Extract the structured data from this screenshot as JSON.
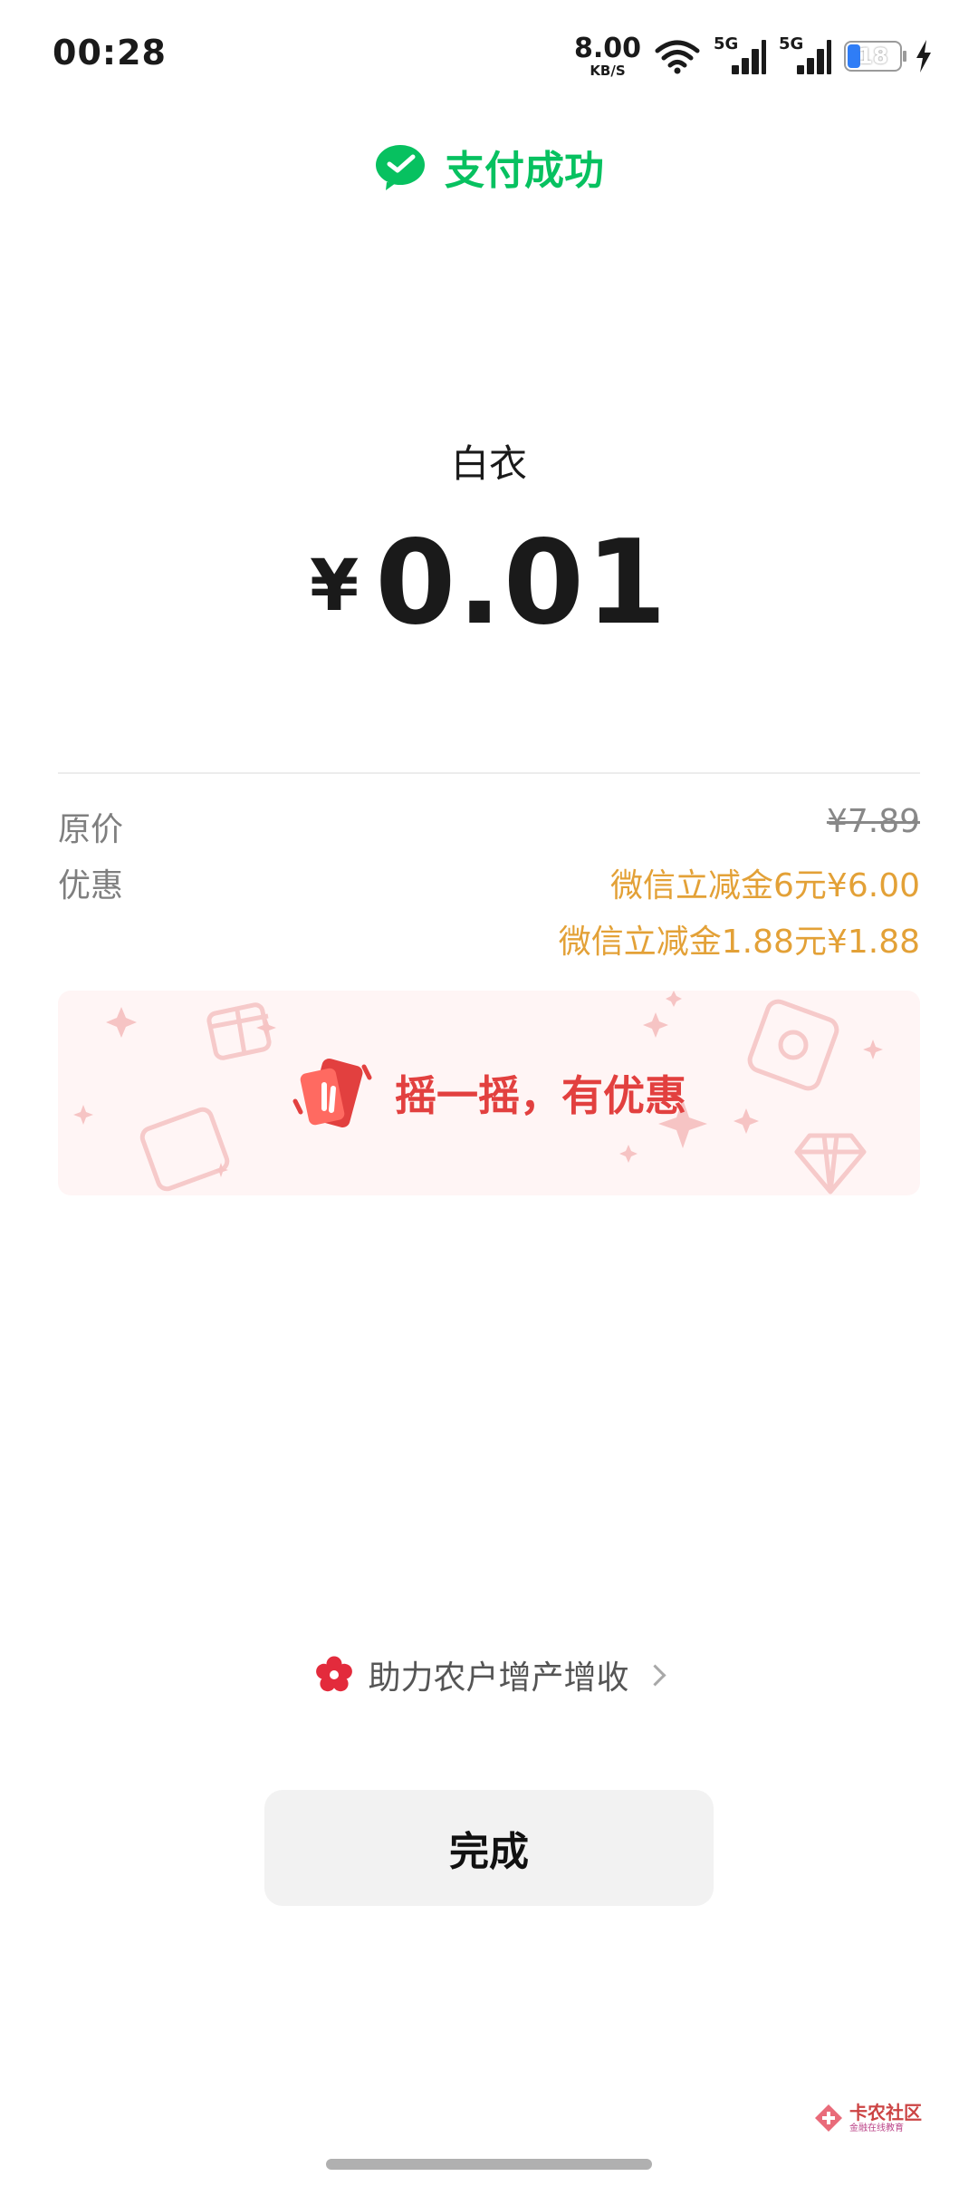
{
  "status_bar": {
    "time": "00:28",
    "net_speed_value": "8.00",
    "net_speed_unit": "KB/S",
    "signal_1": "5G",
    "signal_2": "5G",
    "battery_level": "18",
    "icons": [
      "wifi-icon",
      "signal-icon",
      "signal-icon",
      "battery-icon",
      "charging-icon"
    ]
  },
  "header": {
    "status": "支付成功",
    "icon": "wechat-pay-icon",
    "brand_color": "#07c160"
  },
  "payment": {
    "merchant": "白衣",
    "currency": "¥",
    "amount": "0.01"
  },
  "details": {
    "original_label": "原价",
    "original_price": "¥7.89",
    "discount_label": "优惠",
    "discounts": [
      "微信立减金6元¥6.00",
      "微信立减金1.88元¥1.88"
    ],
    "discount_color": "#e3a137"
  },
  "promo": {
    "text": "摇一摇，有优惠",
    "icon": "shake-phone-icon",
    "color": "#e2403f"
  },
  "farm_link": {
    "text": "助力农户增产增收",
    "icon": "flower-icon"
  },
  "done_button": {
    "label": "完成"
  },
  "watermark": {
    "title": "卡农社区",
    "subtitle": "金融在线教育"
  }
}
